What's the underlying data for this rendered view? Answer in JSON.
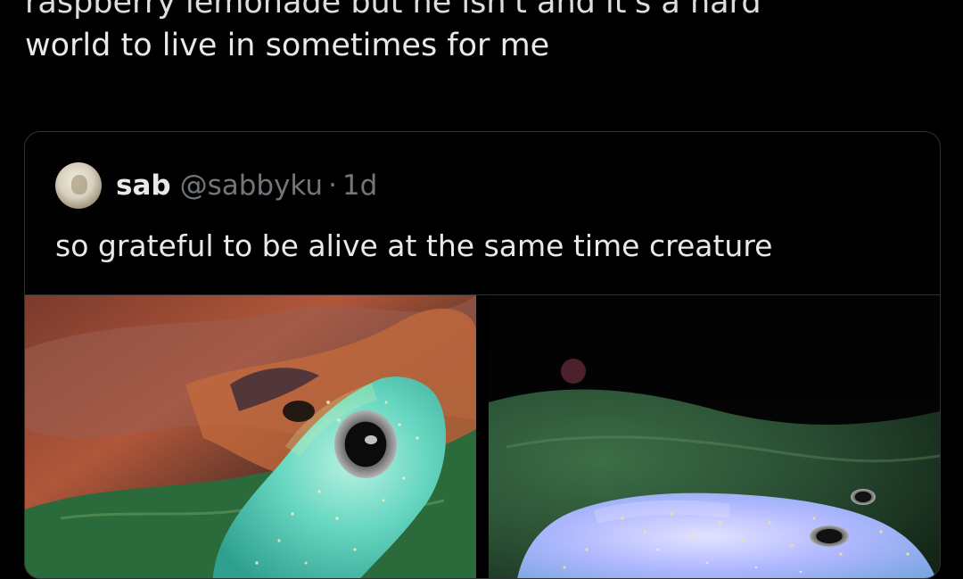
{
  "post": {
    "text_line_1": "raspberry lemonade but he isn't and it's a hard",
    "text_line_2": "world to live in sometimes for me"
  },
  "quote": {
    "name": "sab",
    "handle": "@sabbyku",
    "separator": "·",
    "time": "1d",
    "text": "so grateful to be alive at the same time creature"
  },
  "media": [
    {
      "icon": "frog-photo-1"
    },
    {
      "icon": "frog-photo-2"
    }
  ],
  "colors": {
    "background": "#000000",
    "text": "#e7e9ea",
    "muted": "#71767b",
    "border": "#2f3336"
  }
}
